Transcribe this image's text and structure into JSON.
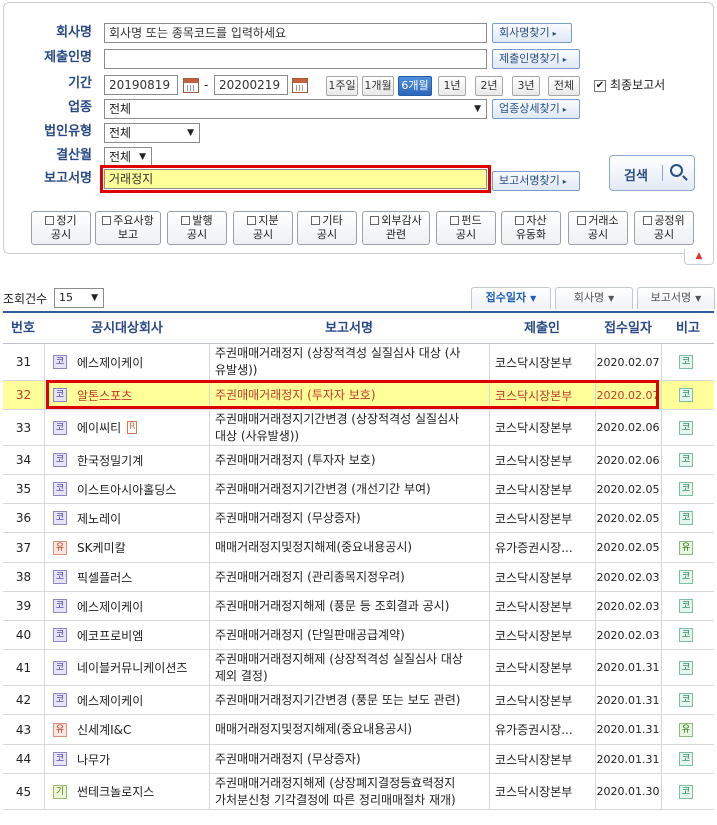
{
  "form": {
    "company_label": "회사명",
    "company_placeholder": "회사명 또는 종목코드를 입력하세요",
    "company_find_btn": "회사명찾기",
    "submitter_label": "제출인명",
    "submitter_find_btn": "제출인명찾기",
    "period_label": "기간",
    "date_from": "20190819",
    "date_sep": "-",
    "date_to": "20200219",
    "period_buttons": [
      "1주일",
      "1개월",
      "6개월",
      "1년",
      "2년",
      "3년",
      "전체"
    ],
    "period_active": "6개월",
    "final_report_label": "최종보고서",
    "final_report_checked": true,
    "industry_label": "업종",
    "industry_value": "전체",
    "industry_detail_btn": "업종상세찾기",
    "corp_type_label": "법인유형",
    "corp_type_value": "전체",
    "fiscal_label": "결산월",
    "fiscal_value": "전체",
    "report_label": "보고서명",
    "report_value": "거래정지",
    "report_find_btn": "보고서명찾기",
    "search_btn": "검색",
    "categories": [
      [
        "정기",
        "공시"
      ],
      [
        "주요사항",
        "보고"
      ],
      [
        "발행",
        "공시"
      ],
      [
        "지분",
        "공시"
      ],
      [
        "기타",
        "공시"
      ],
      [
        "외부감사",
        "관련"
      ],
      [
        "펀드",
        "공시"
      ],
      [
        "자산",
        "유동화"
      ],
      [
        "거래소",
        "공시"
      ],
      [
        "공정위",
        "공시"
      ]
    ]
  },
  "list": {
    "count_label": "조회건수",
    "count_value": "15",
    "sort_tabs": [
      "접수일자",
      "회사명",
      "보고서명"
    ],
    "active_sort": "접수일자",
    "headers": [
      "번호",
      "공시대상회사",
      "보고서명",
      "제출인",
      "접수일자",
      "비고"
    ],
    "rows": [
      {
        "no": "31",
        "mk": "코",
        "company": "에스제이케이",
        "report1": "주권매매거래정지 (상장적격성 실질심사 대상 (사",
        "report2": "유발생))",
        "submitter": "코스닥시장본부",
        "date": "2020.02.07",
        "note": "코"
      },
      {
        "no": "32",
        "mk": "코",
        "company": "알톤스포츠",
        "report1": "주권매매거래정지 (투자자 보호)",
        "report2": "",
        "submitter": "코스닥시장본부",
        "date": "2020.02.07",
        "note": "코"
      },
      {
        "no": "33",
        "mk": "코",
        "company": "에이씨티",
        "tag": "R",
        "report1": "주권매매거래정지기간변경 (상장적격성 실질심사",
        "report2": "대상 (사유발생))",
        "submitter": "코스닥시장본부",
        "date": "2020.02.06",
        "note": "코"
      },
      {
        "no": "34",
        "mk": "코",
        "company": "한국정밀기계",
        "report1": "주권매매거래정지 (투자자 보호)",
        "report2": "",
        "submitter": "코스닥시장본부",
        "date": "2020.02.06",
        "note": "코"
      },
      {
        "no": "35",
        "mk": "코",
        "company": "이스트아시아홀딩스",
        "report1": "주권매매거래정지기간변경 (개선기간 부여)",
        "report2": "",
        "submitter": "코스닥시장본부",
        "date": "2020.02.05",
        "note": "코"
      },
      {
        "no": "36",
        "mk": "코",
        "company": "제노레이",
        "report1": "주권매매거래정지 (무상증자)",
        "report2": "",
        "submitter": "코스닥시장본부",
        "date": "2020.02.05",
        "note": "코"
      },
      {
        "no": "37",
        "mk": "유",
        "company": "SK케미칼",
        "report1": "매매거래정지및정지해제(중요내용공시)",
        "report2": "",
        "submitter": "유가증권시장...",
        "date": "2020.02.05",
        "note": "유"
      },
      {
        "no": "38",
        "mk": "코",
        "company": "픽셀플러스",
        "report1": "주권매매거래정지 (관리종목지정우려)",
        "report2": "",
        "submitter": "코스닥시장본부",
        "date": "2020.02.03",
        "note": "코"
      },
      {
        "no": "39",
        "mk": "코",
        "company": "에스제이케이",
        "report1": "주권매매거래정지해제 (풍문 등 조회결과 공시)",
        "report2": "",
        "submitter": "코스닥시장본부",
        "date": "2020.02.03",
        "note": "코"
      },
      {
        "no": "40",
        "mk": "코",
        "company": "에코프로비엠",
        "report1": "주권매매거래정지 (단일판매공급계약)",
        "report2": "",
        "submitter": "코스닥시장본부",
        "date": "2020.02.03",
        "note": "코"
      },
      {
        "no": "41",
        "mk": "코",
        "company": "네이블커뮤니케이션즈",
        "report1": "주권매매거래정지해제 (상장적격성 실질심사 대상",
        "report2": "제외 결정)",
        "submitter": "코스닥시장본부",
        "date": "2020.01.31",
        "note": "코"
      },
      {
        "no": "42",
        "mk": "코",
        "company": "에스제이케이",
        "report1": "주권매매거래정지기간변경 (풍문 또는 보도 관련)",
        "report2": "",
        "submitter": "코스닥시장본부",
        "date": "2020.01.31",
        "note": "코"
      },
      {
        "no": "43",
        "mk": "유",
        "company": "신세계I&C",
        "report1": "매매거래정지및정지해제(중요내용공시)",
        "report2": "",
        "submitter": "유가증권시장...",
        "date": "2020.01.31",
        "note": "유"
      },
      {
        "no": "44",
        "mk": "코",
        "company": "나무가",
        "report1": "주권매매거래정지 (무상증자)",
        "report2": "",
        "submitter": "코스닥시장본부",
        "date": "2020.01.31",
        "note": "코"
      },
      {
        "no": "45",
        "mk": "기",
        "company": "썬테크놀로지스",
        "report1": "주권매매거래정지해제 (상장폐지결정등효력정지",
        "report2": "가처분신청 기각결정에 따른 정리매매절차 재개)",
        "submitter": "코스닥시장본부",
        "date": "2020.01.30",
        "note": "코"
      }
    ]
  }
}
